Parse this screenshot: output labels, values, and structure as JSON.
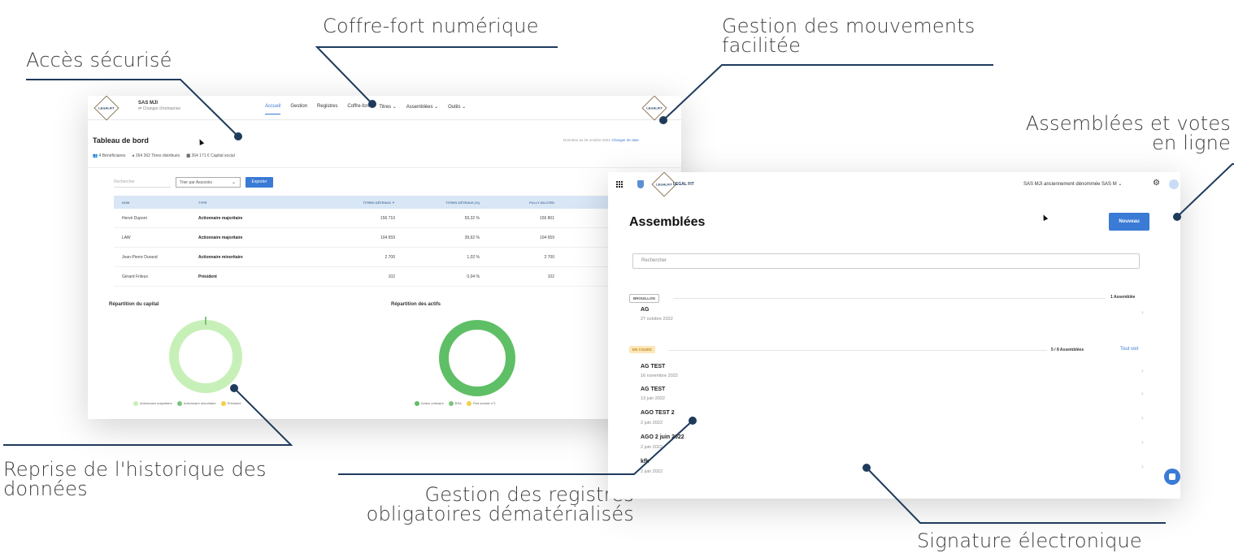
{
  "callouts": {
    "acces": "Accès sécurisé",
    "coffre": "Coffre-fort numérique",
    "mouvements_1": "Gestion des mouvements",
    "mouvements_2": "facilitée",
    "assemblees_1": "Assemblées et votes",
    "assemblees_2": "en ligne",
    "reprise_1": "Reprise de l'historique des",
    "reprise_2": "données",
    "registres_1": "Gestion des registres",
    "registres_2": "obligatoires dématérialisés",
    "signature": "Signature électronique"
  },
  "dashboard": {
    "logo_text": "LEGALFIT",
    "company_name": "SAS MJI",
    "change_company": "⇄ Changer d'entreprise",
    "nav": [
      "Accueil",
      "Gestion",
      "Registres",
      "Coffre-fort",
      "Titres ⌄",
      "Assemblées ⌄",
      "Outils ⌄"
    ],
    "title": "Tableau de bord",
    "date_prefix": "Données au 25 octobre 2021",
    "date_link": "Changer de date",
    "stats": {
      "beneficiaires": "4 Bénéficiaires",
      "titres": "264 262 Titres distribués",
      "capital": "264 171 € Capital social"
    },
    "search_placeholder": "Rechercher",
    "sort_select": "Trier par Associés",
    "export_button": "Exporter",
    "table": {
      "headers": [
        "NOM",
        "TYPE",
        "TITRES DÉTENUS ▼",
        "TITRES DÉTENUS (%)",
        "FULLY DILUTED"
      ],
      "rows": [
        [
          "Hervé Dupont",
          "Actionnaire majoritaire",
          "156 710",
          "59,32 %",
          "156 801"
        ],
        [
          "LAW",
          "Actionnaire majoritaire",
          "104 659",
          "39,62 %",
          "104 659"
        ],
        [
          "Jean-Pierre Durand",
          "Actionnaire minoritaire",
          "2 700",
          "1,02 %",
          "2 700"
        ],
        [
          "Gérard Frileux",
          "Président",
          "102",
          "0,04 %",
          "102"
        ]
      ]
    },
    "chart_capital": {
      "title": "Répartition du capital",
      "legend": [
        "Actionnaire majoritaire",
        "Actionnaire minoritaire",
        "Président"
      ],
      "colors": [
        "#c7f0b8",
        "#7bc47f",
        "#f2d04a"
      ]
    },
    "chart_actifs": {
      "title": "Répartition des actifs",
      "legend": [
        "Action ordinaire",
        "BSA",
        "Part sociale n°1"
      ],
      "colors": [
        "#5fbf66",
        "#7bc47f",
        "#f2d04a"
      ]
    }
  },
  "assemblies": {
    "brand": "LEGAL FIT",
    "company": "SAS MJI anciennement dénommée SAS M ⌄",
    "title": "Assemblées",
    "new_button": "Nouveau",
    "search_placeholder": "Rechercher",
    "draft": {
      "badge": "BROUILLON",
      "count": "1 Assemblée",
      "items": [
        {
          "title": "AG",
          "date": "27 octobre 2022"
        }
      ]
    },
    "ongoing": {
      "badge": "EN COURS",
      "count": "5 / 8 Assemblées",
      "see_all": "Tout voir",
      "items": [
        {
          "title": "AG TEST",
          "date": "16 novembre 2022"
        },
        {
          "title": "AG TEST",
          "date": "13 juin 2022"
        },
        {
          "title": "AGO TEST 2",
          "date": "2 juin 2022"
        },
        {
          "title": "AGO 2 juin 2022",
          "date": "2 juin 2022"
        },
        {
          "title": "kfk",
          "date": "2 juin 2022"
        }
      ]
    }
  }
}
